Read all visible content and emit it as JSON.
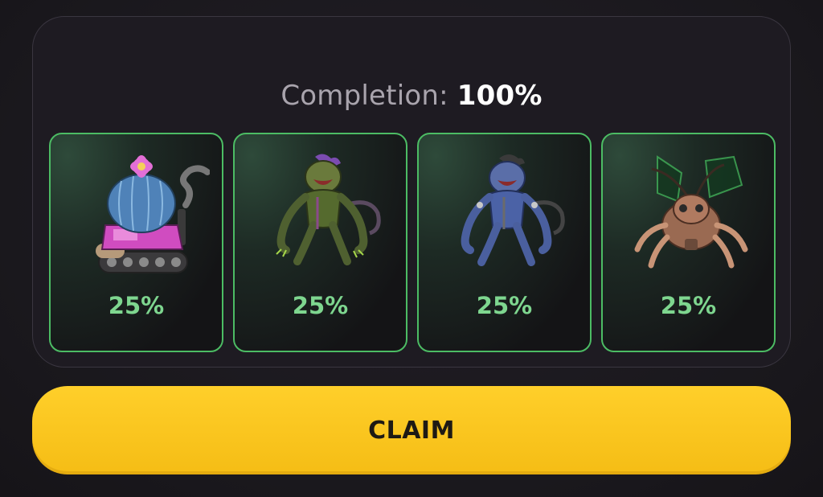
{
  "completion": {
    "label": "Completion:",
    "value": "100%"
  },
  "cards": [
    {
      "icon": "cactus-tank-creature-icon",
      "percent": "25%"
    },
    {
      "icon": "green-mutant-creature-icon",
      "percent": "25%"
    },
    {
      "icon": "blue-mutant-creature-icon",
      "percent": "25%"
    },
    {
      "icon": "robot-insect-creature-icon",
      "percent": "25%"
    }
  ],
  "claim_button": {
    "label": "CLAIM"
  },
  "colors": {
    "accent_green": "#4cbc64",
    "percent_green": "#7ed68f",
    "claim_yellow": "#f5bd15",
    "background": "#1c1a1f"
  }
}
